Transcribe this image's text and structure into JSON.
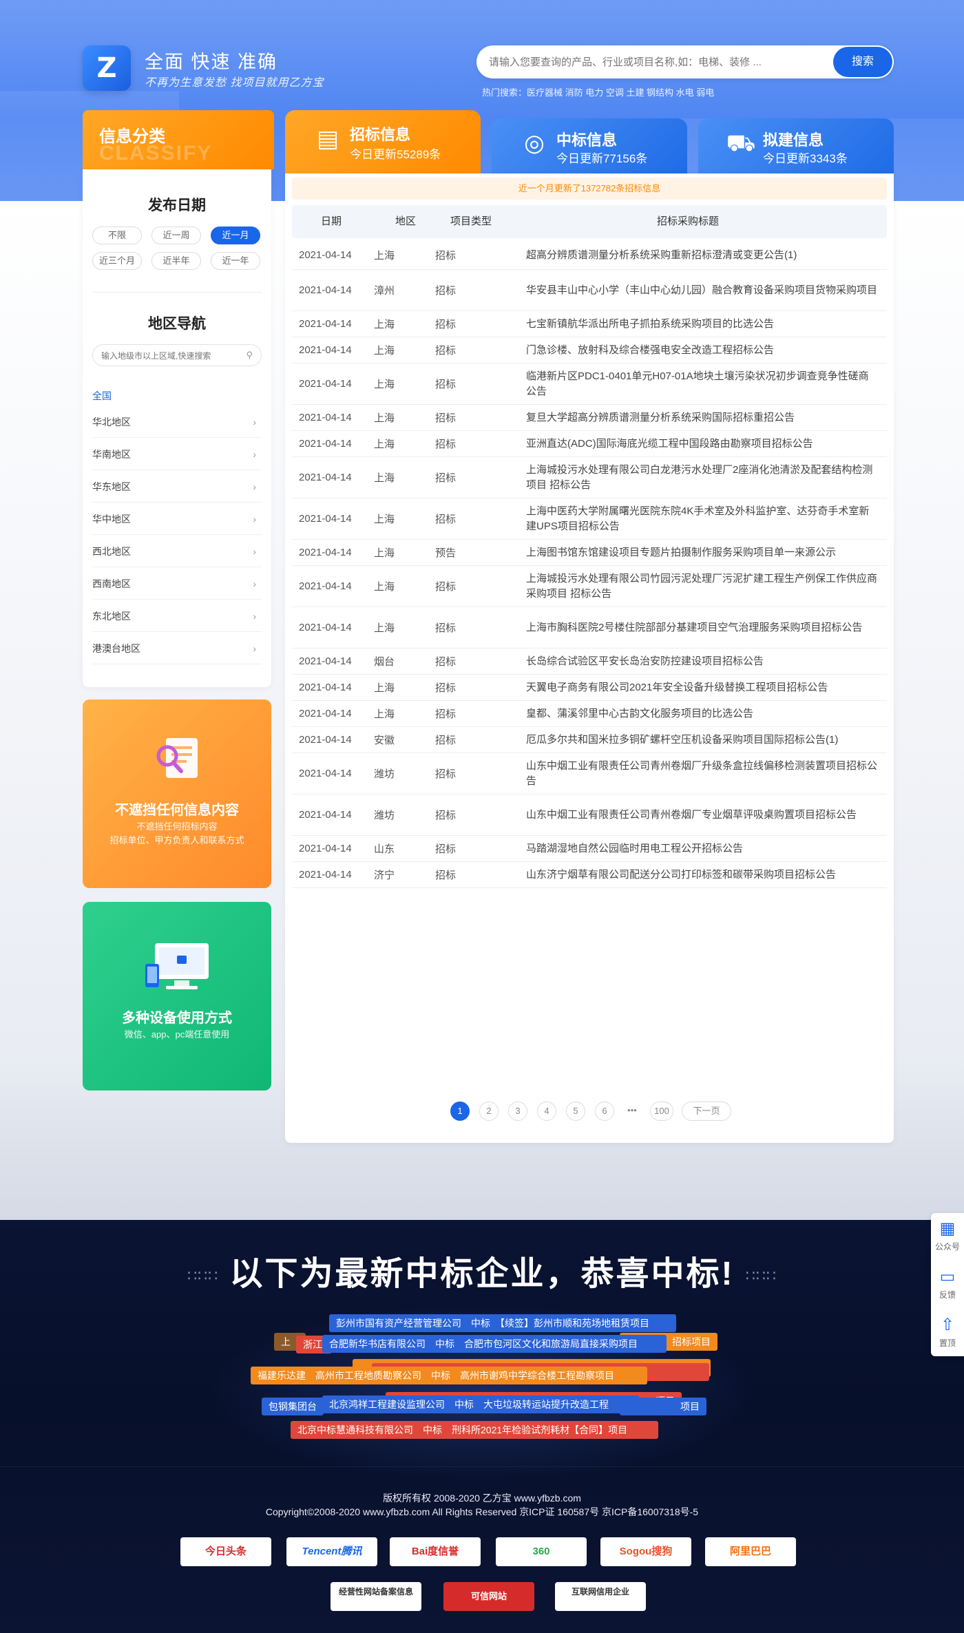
{
  "header": {
    "logo_text": "Z",
    "title": "全面 快速 准确",
    "subtitle": "不再为生意发愁 找项目就用乙方宝",
    "search_placeholder": "请输入您要查询的产品、行业或项目名称,如：电梯、装修 ...",
    "search_button": "搜索",
    "hot_search": "热门搜索：医疗器械 消防 电力 空调 土建 钢结构 水电 弱电"
  },
  "classify": {
    "title": "信息分类",
    "title_en": "CLASSIFY",
    "date_title": "发布日期",
    "date_options": [
      "不限",
      "近一周",
      "近一月",
      "近三个月",
      "近半年",
      "近一年"
    ],
    "date_selected": "近一月",
    "region_title": "地区导航",
    "region_placeholder": "输入地级市以上区域,快速搜索",
    "regions": [
      "全国",
      "华北地区",
      "华南地区",
      "华东地区",
      "华中地区",
      "西北地区",
      "西南地区",
      "东北地区",
      "港澳台地区"
    ]
  },
  "promos": [
    {
      "title": "不遮挡任何信息内容",
      "line1": "不遮挡任何招标内容",
      "line2": "招标单位、甲方负责人和联系方式"
    },
    {
      "title": "多种设备使用方式",
      "line1": "微信、app、pc端任意使用",
      "line2": ""
    }
  ],
  "tabs": [
    {
      "title": "招标信息",
      "sub": "今日更新55289条",
      "icon": "briefcase-icon"
    },
    {
      "title": "中标信息",
      "sub": "今日更新77156条",
      "icon": "target-icon"
    },
    {
      "title": "拟建信息",
      "sub": "今日更新3343条",
      "icon": "construction-icon"
    }
  ],
  "notice": "近一个月更新了1372782条招标信息",
  "table": {
    "headers": [
      "日期",
      "地区",
      "项目类型",
      "招标采购标题"
    ],
    "rows": [
      {
        "date": "2021-04-14",
        "region": "上海",
        "type": "招标",
        "title": "超高分辨质谱测量分析系统采购重新招标澄清或变更公告(1)"
      },
      {
        "date": "2021-04-14",
        "region": "漳州",
        "type": "招标",
        "title": "华安县丰山中心小学（丰山中心幼儿园）融合教育设备采购项目货物采购项目"
      },
      {
        "date": "2021-04-14",
        "region": "上海",
        "type": "招标",
        "title": "七宝新镇航华派出所电子抓拍系统采购项目的比选公告"
      },
      {
        "date": "2021-04-14",
        "region": "上海",
        "type": "招标",
        "title": "门急诊楼、放射科及综合楼强电安全改造工程招标公告"
      },
      {
        "date": "2021-04-14",
        "region": "上海",
        "type": "招标",
        "title": "临港新片区PDC1-0401单元H07-01A地块土壤污染状况初步调查竞争性磋商公告"
      },
      {
        "date": "2021-04-14",
        "region": "上海",
        "type": "招标",
        "title": "复旦大学超高分辨质谱测量分析系统采购国际招标重招公告"
      },
      {
        "date": "2021-04-14",
        "region": "上海",
        "type": "招标",
        "title": "亚洲直达(ADC)国际海底光缆工程中国段路由勘察项目招标公告"
      },
      {
        "date": "2021-04-14",
        "region": "上海",
        "type": "招标",
        "title": "上海城投污水处理有限公司白龙港污水处理厂2座消化池清淤及配套结构检测项目 招标公告"
      },
      {
        "date": "2021-04-14",
        "region": "上海",
        "type": "招标",
        "title": "上海中医药大学附属曙光医院东院4K手术室及外科监护室、达芬奇手术室新建UPS项目招标公告"
      },
      {
        "date": "2021-04-14",
        "region": "上海",
        "type": "预告",
        "title": "上海图书馆东馆建设项目专题片拍摄制作服务采购项目单一来源公示"
      },
      {
        "date": "2021-04-14",
        "region": "上海",
        "type": "招标",
        "title": "上海城投污水处理有限公司竹园污泥处理厂污泥扩建工程生产例保工作供应商采购项目 招标公告"
      },
      {
        "date": "2021-04-14",
        "region": "上海",
        "type": "招标",
        "title": "上海市胸科医院2号楼住院部部分基建项目空气治理服务采购项目招标公告"
      },
      {
        "date": "2021-04-14",
        "region": "烟台",
        "type": "招标",
        "title": "长岛综合试验区平安长岛治安防控建设项目招标公告"
      },
      {
        "date": "2021-04-14",
        "region": "上海",
        "type": "招标",
        "title": "天翼电子商务有限公司2021年安全设备升级替换工程项目招标公告"
      },
      {
        "date": "2021-04-14",
        "region": "上海",
        "type": "招标",
        "title": "皇都、蒲溪邻里中心古韵文化服务项目的比选公告"
      },
      {
        "date": "2021-04-14",
        "region": "安徽",
        "type": "招标",
        "title": "厄瓜多尔共和国米拉多铜矿螺杆空压机设备采购项目国际招标公告(1)"
      },
      {
        "date": "2021-04-14",
        "region": "潍坊",
        "type": "招标",
        "title": "山东中烟工业有限责任公司青州卷烟厂升级条盒拉线偏移检测装置项目招标公告"
      },
      {
        "date": "2021-04-14",
        "region": "潍坊",
        "type": "招标",
        "title": "山东中烟工业有限责任公司青州卷烟厂专业烟草评吸桌购置项目招标公告"
      },
      {
        "date": "2021-04-14",
        "region": "山东",
        "type": "招标",
        "title": "马踏湖湿地自然公园临时用电工程公开招标公告"
      },
      {
        "date": "2021-04-14",
        "region": "济宁",
        "type": "招标",
        "title": "山东济宁烟草有限公司配送分公司打印标签和碳带采购项目招标公告"
      }
    ]
  },
  "pagination": {
    "pages": [
      "1",
      "2",
      "3",
      "4",
      "5",
      "6"
    ],
    "ellipsis": "•••",
    "last": "100",
    "next": "下一页",
    "current": "1"
  },
  "winners": {
    "title": "以下为最新中标企业，恭喜中标!",
    "dots": "∷∷∷",
    "tags": [
      "彭州市国有资产经营管理公司　中标　【续签】彭州市顺和苑场地租赁项目",
      "合肥新华书店有限公司　中标　合肥市包河区文化和旅游局直接采购项目",
      "福建乐达建　高州市工程地质勘察公司　中标　高州市谢鸡中学综合楼工程勘察项目",
      "北京鸿祥工程建设监理公司　中标　大屯垃圾转运站提升改造工程",
      "北京中标慧通科技有限公司　中标　刑科所2021年检验试剂耗材【合同】项目",
      "浙江",
      "上",
      "项目",
      "包钢集团台",
      "项目",
      "招标项目",
      "采购项目"
    ]
  },
  "footer": {
    "copyright": "版权所有权 2008-2020 乙方宝 www.yfbzb.com",
    "copyright_en": "Copyright©2008-2020 www.yfbzb.com All Rights Reserved 京ICP证 160587号 京ICP备16007318号-5",
    "partners": [
      "今日头条",
      "Tencent腾讯",
      "Bai度信誉",
      "360",
      "Sogou搜狗",
      "阿里巴巴"
    ],
    "badges": [
      "经营性网站备案信息",
      "可信网站",
      "互联网信用企业"
    ]
  },
  "side_tools": [
    "公众号",
    "反馈",
    "置顶"
  ],
  "colors": {
    "primary": "#1a66e8",
    "orange": "#ff8a00",
    "green": "#10b774"
  }
}
